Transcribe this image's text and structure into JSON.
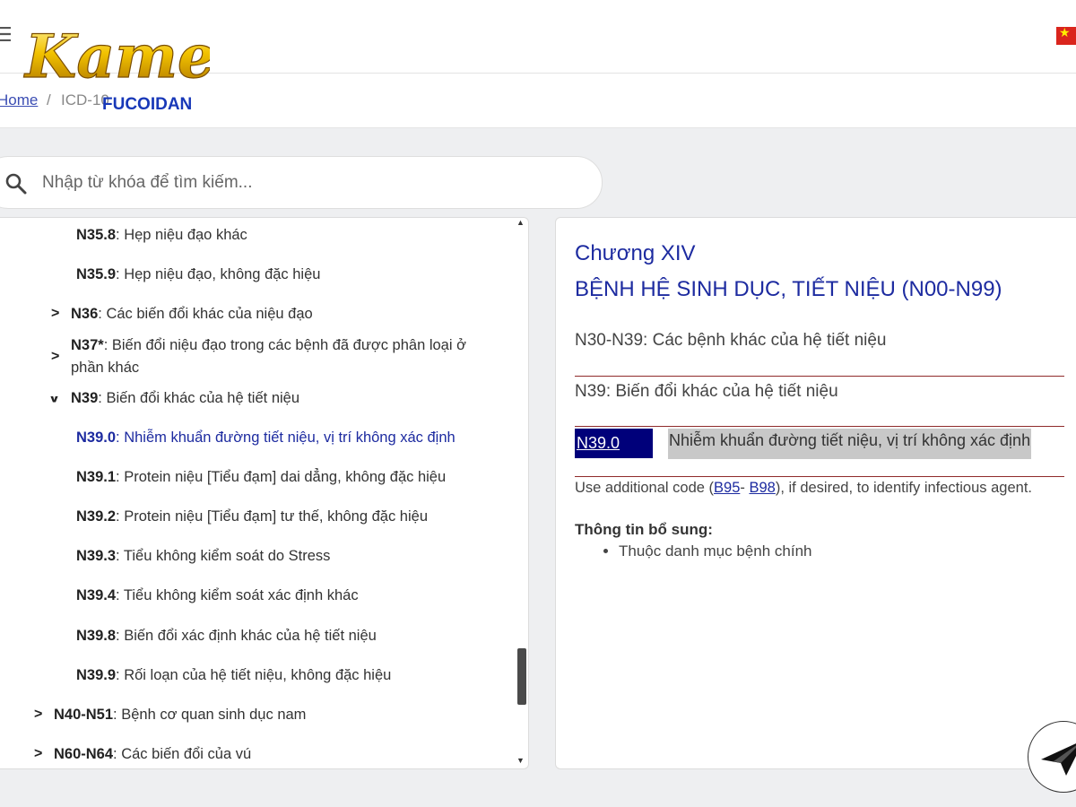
{
  "header": {
    "logo_main": "Kame",
    "logo_sub": "FUCOIDAN"
  },
  "breadcrumb": {
    "home": "Home",
    "separator": "/",
    "current": "ICD-10"
  },
  "search": {
    "placeholder": "Nhập từ khóa để tìm kiếm..."
  },
  "tree": {
    "items": [
      {
        "code": "N35.8",
        "label": ": Hẹp niệu đạo khác"
      },
      {
        "code": "N35.9",
        "label": ": Hẹp niệu đạo, không đặc hiệu"
      },
      {
        "code": "N36",
        "label": ": Các biến đổi khác của niệu đạo",
        "toggle": ">"
      },
      {
        "code": "N37*",
        "label": ": Biến đổi niệu đạo trong các bệnh đã được phân loại ở",
        "label2": "phần khác",
        "toggle": ">"
      },
      {
        "code": "N39",
        "label": ": Biến đổi khác của hệ tiết niệu",
        "toggle": "v"
      },
      {
        "code": "N39.0",
        "label": ": Nhiễm khuẩn đường tiết niệu, vị trí không xác định"
      },
      {
        "code": "N39.1",
        "label": ": Protein niệu [Tiểu đạm] dai dẳng, không đặc hiệu"
      },
      {
        "code": "N39.2",
        "label": ": Protein niệu [Tiểu đạm] tư thế, không đặc hiệu"
      },
      {
        "code": "N39.3",
        "label": ": Tiểu không kiểm soát do Stress"
      },
      {
        "code": "N39.4",
        "label": ": Tiểu không kiểm soát xác định khác"
      },
      {
        "code": "N39.8",
        "label": ": Biến đổi xác định khác của hệ tiết niệu"
      },
      {
        "code": "N39.9",
        "label": ": Rối loạn của hệ tiết niệu, không đặc hiệu"
      },
      {
        "code": "N40-N51",
        "label": ": Bệnh cơ quan sinh dục nam",
        "toggle": ">"
      },
      {
        "code": "N60-N64",
        "label": ": Các biến đổi của vú",
        "toggle": ">"
      }
    ]
  },
  "detail": {
    "chapter": "Chương XIV",
    "chapter_title": "BỆNH HỆ SINH DỤC, TIẾT NIỆU (N00-N99)",
    "group": "N30-N39: Các bệnh khác của hệ tiết niệu",
    "subgroup": "N39: Biến đổi khác của hệ tiết niệu",
    "code": "N39.0",
    "code_desc": "Nhiễm khuẩn đường tiết niệu, vị trí không xác định",
    "note_prefix": "Use additional code (",
    "note_link1": "B95",
    "note_mid": "- ",
    "note_link2": "B98",
    "note_suffix": "), if desired, to identify infectious agent.",
    "extra_title": "Thông tin bổ sung:",
    "extra_items": [
      "Thuộc danh mục bệnh chính"
    ]
  },
  "colors": {
    "accent": "#1d2ba0",
    "code_bg": "#00007a",
    "divider": "#8f2b2b",
    "highlight": "#c8c8c8",
    "page_bg": "#eeeff1"
  }
}
